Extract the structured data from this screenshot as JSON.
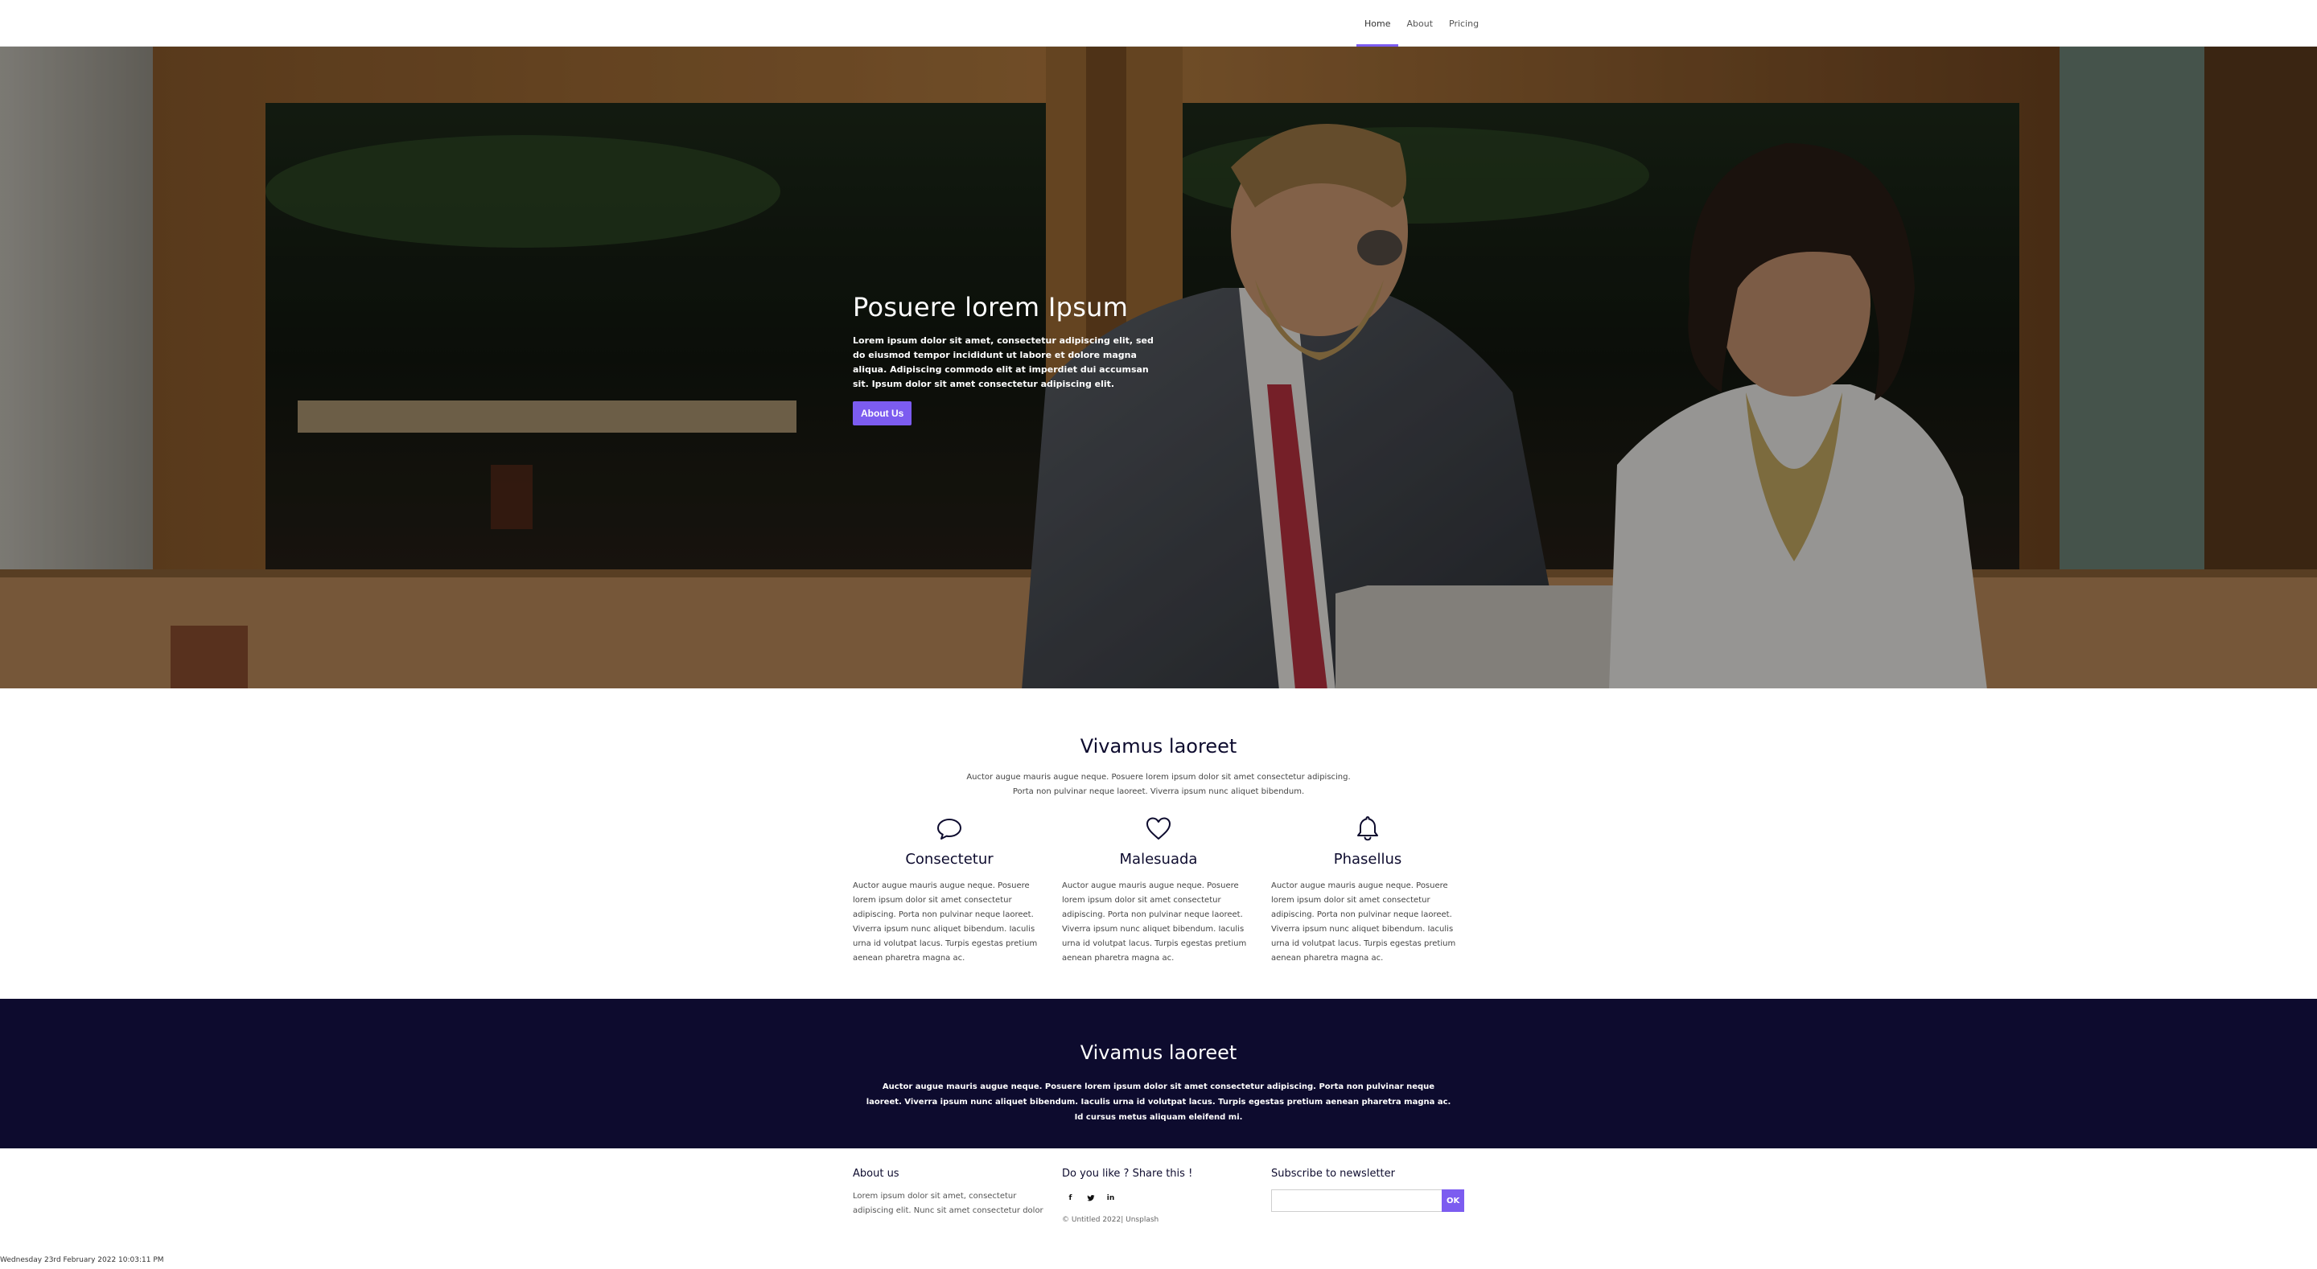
{
  "nav": {
    "items": [
      {
        "label": "Home",
        "active": true
      },
      {
        "label": "About",
        "active": false
      },
      {
        "label": "Pricing",
        "active": false
      }
    ]
  },
  "hero": {
    "title": "Posuere lorem Ipsum",
    "text": "Lorem ipsum dolor sit amet, consectetur adipiscing elit, sed do eiusmod tempor incididunt ut labore et dolore magna aliqua. Adipiscing commodo elit at imperdiet dui accumsan sit. Ipsum dolor sit amet consectetur adipiscing elit.",
    "button_label": "About Us"
  },
  "features": {
    "title": "Vivamus laoreet",
    "subtitle": "Auctor augue mauris augue neque. Posuere lorem ipsum dolor sit amet consectetur adipiscing. Porta non pulvinar neque laoreet. Viverra ipsum nunc aliquet bibendum.",
    "items": [
      {
        "icon": "chat-bubble-icon",
        "title": "Consectetur",
        "text": "Auctor augue mauris augue neque. Posuere lorem ipsum dolor sit amet consectetur adipiscing. Porta non pulvinar neque laoreet. Viverra ipsum nunc aliquet bibendum. Iaculis urna id volutpat lacus. Turpis egestas pretium aenean pharetra magna ac."
      },
      {
        "icon": "heart-icon",
        "title": "Malesuada",
        "text": "Auctor augue mauris augue neque. Posuere lorem ipsum dolor sit amet consectetur adipiscing. Porta non pulvinar neque laoreet. Viverra ipsum nunc aliquet bibendum. Iaculis urna id volutpat lacus. Turpis egestas pretium aenean pharetra magna ac."
      },
      {
        "icon": "bell-icon",
        "title": "Phasellus",
        "text": "Auctor augue mauris augue neque. Posuere lorem ipsum dolor sit amet consectetur adipiscing. Porta non pulvinar neque laoreet. Viverra ipsum nunc aliquet bibendum. Iaculis urna id volutpat lacus. Turpis egestas pretium aenean pharetra magna ac."
      }
    ]
  },
  "band": {
    "title": "Vivamus laoreet",
    "text": "Auctor augue mauris augue neque. Posuere lorem ipsum dolor sit amet consectetur adipiscing. Porta non pulvinar neque laoreet. Viverra ipsum nunc aliquet bibendum. Iaculis urna id volutpat lacus. Turpis egestas pretium aenean pharetra magna ac. Id cursus metus aliquam eleifend mi."
  },
  "footer": {
    "about": {
      "heading": "About us",
      "text": "Lorem ipsum dolor sit amet, consectetur adipiscing elit. Nunc sit amet consectetur dolor"
    },
    "share": {
      "heading": "Do you like ? Share this !",
      "icons": [
        {
          "name": "facebook-icon",
          "glyph": "f"
        },
        {
          "name": "twitter-icon",
          "glyph": "🐦"
        },
        {
          "name": "linkedin-icon",
          "glyph": "in"
        }
      ],
      "copyright": "© Untitled 2022| Unsplash"
    },
    "newsletter": {
      "heading": "Subscribe to newsletter",
      "input_value": "",
      "input_placeholder": "",
      "button_label": "OK"
    }
  },
  "timestamp": "Wednesday 23rd February 2022 10:03:11 PM",
  "colors": {
    "accent": "#7c5cf0",
    "dark_band": "#0d0b2e"
  }
}
